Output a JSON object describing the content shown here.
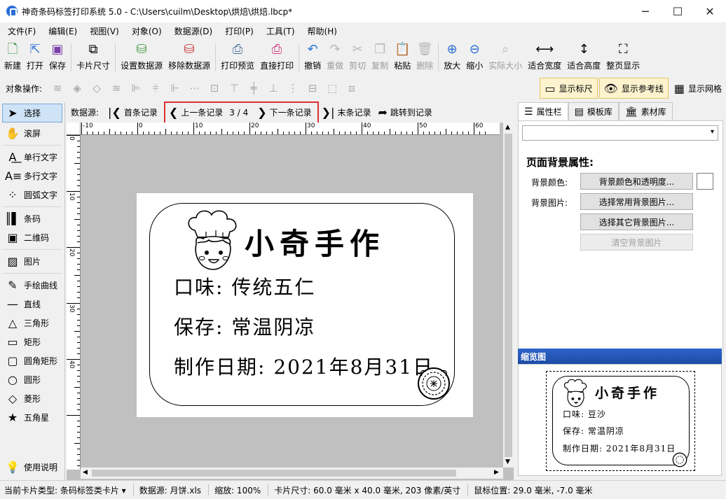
{
  "window": {
    "title": "神奇条码标签打印系统 5.0 - C:\\Users\\cuilm\\Desktop\\烘焙\\烘焙.lbcp*",
    "minimize": "─",
    "maximize": "☐",
    "close": "✕"
  },
  "menu": [
    "文件(F)",
    "编辑(E)",
    "视图(V)",
    "对象(O)",
    "数据源(D)",
    "打印(P)",
    "工具(T)",
    "帮助(H)"
  ],
  "toolbar": {
    "new": "新建",
    "open": "打开",
    "save": "保存",
    "card_size": "卡片尺寸",
    "set_datasource": "设置数据源",
    "remove_datasource": "移除数据源",
    "print_preview": "打印预览",
    "direct_print": "直接打印",
    "undo": "撤销",
    "redo": "重做",
    "cut": "剪切",
    "copy": "复制",
    "paste": "粘贴",
    "delete": "删除",
    "zoom_in": "放大",
    "zoom_out": "缩小",
    "actual_size": "实际大小",
    "fit_width": "适合宽度",
    "fit_height": "适合高度",
    "fit_page": "整页显示"
  },
  "objbar": {
    "label": "对象操作:",
    "show_ruler": "显示标尺",
    "show_guides": "显示参考线",
    "show_grid": "显示网格"
  },
  "tools": {
    "select": "选择",
    "scroll": "滚屏",
    "single_text": "单行文字",
    "multi_text": "多行文字",
    "arc_text": "圆弧文字",
    "barcode": "条码",
    "qrcode": "二维码",
    "image": "图片",
    "freehand": "手绘曲线",
    "line": "直线",
    "triangle": "三角形",
    "rectangle": "矩形",
    "round_rect": "圆角矩形",
    "circle": "圆形",
    "diamond": "菱形",
    "star": "五角星",
    "help": "使用说明"
  },
  "nav": {
    "datasource_label": "数据源:",
    "first": "首条记录",
    "prev": "上一条记录",
    "position": "3 / 4",
    "next": "下一条记录",
    "last": "末条记录",
    "jump": "跳转到记录"
  },
  "ruler": {
    "h_ticks": [
      "-10",
      "0",
      "10",
      "20",
      "30",
      "40",
      "50",
      "60"
    ],
    "v_ticks": [
      "0",
      "10",
      "20",
      "30",
      "40"
    ]
  },
  "label": {
    "title": "小奇手作",
    "flavor": "口味:  传统五仁",
    "storage": "保存:  常温阴凉",
    "date": "制作日期:  2021年8月31日"
  },
  "right": {
    "tabs": [
      "属性栏",
      "模板库",
      "素材库"
    ],
    "combo_value": "",
    "section_title": "页面背景属性:",
    "bg_color_label": "背景颜色:",
    "bg_color_btn": "背景颜色和透明度...",
    "bg_image_label": "背景图片:",
    "common_bg_btn": "选择常用背景图片...",
    "other_bg_btn": "选择其它背景图片...",
    "clear_bg_btn": "清空背景图片",
    "preview_title": "缩览图"
  },
  "preview": {
    "title": "小奇手作",
    "flavor": "口味:  豆沙",
    "storage": "保存:  常温阴凉",
    "date": "制作日期:  2021年8月31日"
  },
  "status": {
    "card_type": "当前卡片类型:  条码标签类卡片 ▾",
    "datasource": "数据源:  月饼.xls",
    "zoom": "缩放:  100%",
    "card_size": "卡片尺寸:  60.0 毫米 x 40.0 毫米, 203 像素/英寸",
    "mouse": "鼠标位置:  29.0 毫米,  -7.0 毫米"
  },
  "colors": {
    "accent": "#1c4ba6",
    "highlight": "#e03030",
    "toggle_on": "#fdf3cf",
    "canvas_bg": "#c0c0c0"
  }
}
